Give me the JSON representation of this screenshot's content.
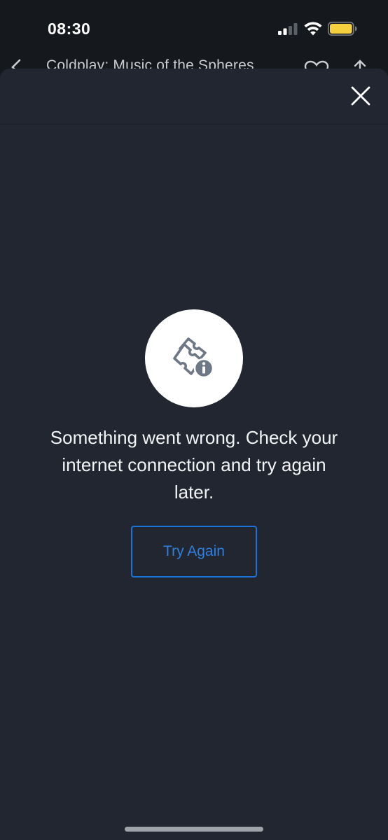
{
  "status_bar": {
    "time": "08:30",
    "battery_color": "#f4d03f"
  },
  "under_header": {
    "title": "Coldplay: Music of the Spheres"
  },
  "sheet": {
    "close_icon": "close-icon",
    "error_icon": "ticket-info-icon",
    "error_message": "Something went wrong. Check your internet connection and try again later.",
    "try_again_label": "Try Again",
    "accent_color": "#1a73d8"
  }
}
